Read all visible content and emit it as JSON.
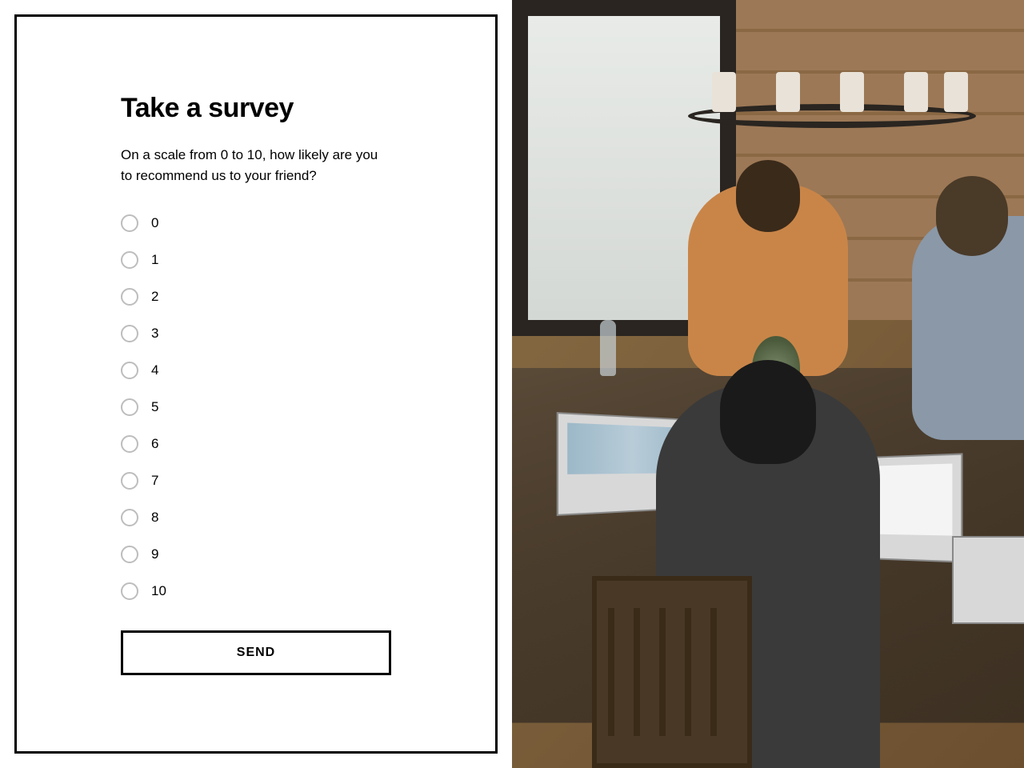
{
  "survey": {
    "title": "Take a survey",
    "question": "On a scale from 0 to 10, how likely are you to recommend us to your friend?",
    "options": [
      "0",
      "1",
      "2",
      "3",
      "4",
      "5",
      "6",
      "7",
      "8",
      "9",
      "10"
    ],
    "submit_label": "SEND"
  }
}
